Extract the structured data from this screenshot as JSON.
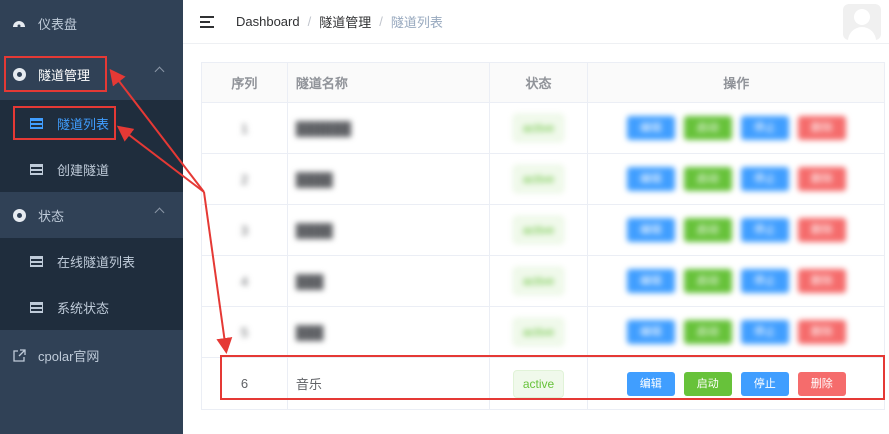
{
  "sidebar": {
    "dashboard_label": "仪表盘",
    "tunnel_mgmt_label": "隧道管理",
    "tunnel_list_label": "隧道列表",
    "create_tunnel_label": "创建隧道",
    "status_label": "状态",
    "online_tunnels_label": "在线隧道列表",
    "system_status_label": "系统状态",
    "cpolar_site_label": "cpolar官网"
  },
  "header": {
    "breadcrumb": [
      "Dashboard",
      "隧道管理",
      "隧道列表"
    ],
    "separator": "/"
  },
  "table": {
    "headers": [
      "序列",
      "隧道名称",
      "状态",
      "操作"
    ],
    "blurred_rows": [
      {
        "index": "1",
        "name": "██████",
        "status": "active"
      },
      {
        "index": "2",
        "name": "████",
        "status": "active"
      },
      {
        "index": "3",
        "name": "████",
        "status": "active"
      },
      {
        "index": "4",
        "name": "███",
        "status": "active"
      },
      {
        "index": "5",
        "name": "███",
        "status": "active"
      }
    ],
    "visible_row": {
      "index": "6",
      "name": "音乐",
      "status": "active"
    },
    "actions": {
      "edit": "编辑",
      "start": "启动",
      "stop": "停止",
      "delete": "删除"
    }
  },
  "colors": {
    "sidebar_bg": "#304156",
    "submenu_bg": "#1f2d3d",
    "accent": "#409eff",
    "success": "#67c23a",
    "danger": "#f56c6c",
    "annotation": "#e53935"
  }
}
